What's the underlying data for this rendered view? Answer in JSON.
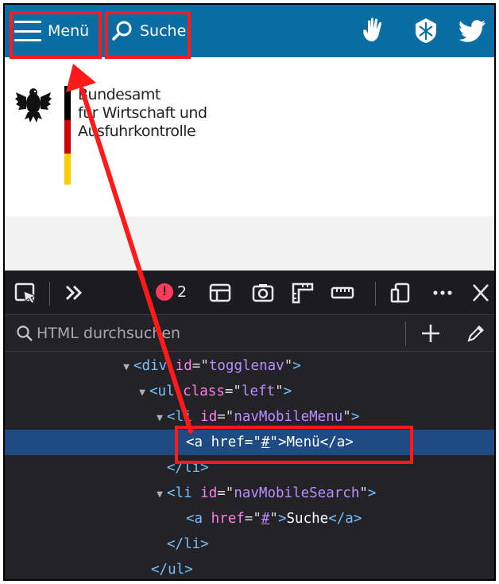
{
  "topnav": {
    "menu_label": "Menü",
    "search_label": "Suche",
    "icons": [
      "hand-icon",
      "federal-shield-icon",
      "twitter-icon"
    ],
    "bg_color": "#0a6ea5"
  },
  "org": {
    "name_line1": "Bundesamt",
    "name_line2": "für Wirtschaft und",
    "name_line3": "Ausfuhrkontrolle"
  },
  "devtools": {
    "error_count": "2",
    "search_placeholder": "HTML durchsuchen",
    "tree": [
      {
        "tag": "div",
        "attr": "id",
        "value": "togglenav"
      },
      {
        "tag": "ul",
        "attr": "class",
        "value": "left"
      },
      {
        "tag": "li",
        "attr": "id",
        "value": "navMobileMenu"
      },
      {
        "tag": "a",
        "attr": "href",
        "value": "#",
        "text": "Menü"
      },
      {
        "close": "li"
      },
      {
        "tag": "li",
        "attr": "id",
        "value": "navMobileSearch"
      },
      {
        "tag": "a",
        "attr": "href",
        "value": "#",
        "text": "Suche"
      },
      {
        "close": "li"
      },
      {
        "close": "ul"
      }
    ]
  },
  "colors": {
    "annotation": "#ff1a1a",
    "selection": "#1f4b85"
  }
}
